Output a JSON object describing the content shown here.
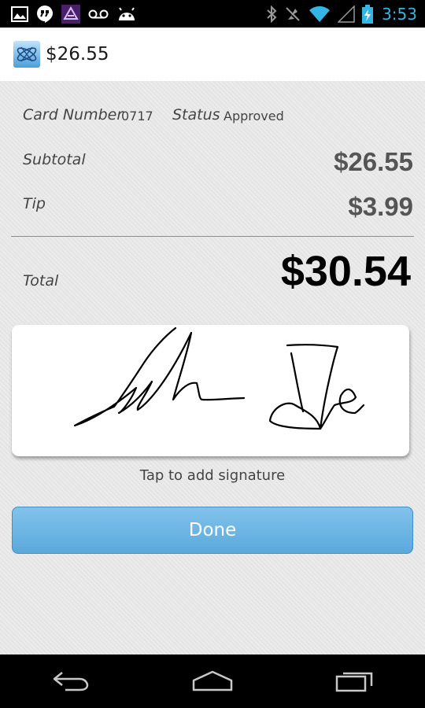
{
  "status_bar": {
    "time": "3:53",
    "time_color": "#33b5e5",
    "notification_icons": [
      "gallery-icon",
      "hangouts-icon",
      "app-notification-icon",
      "voicemail-icon",
      "android-icon"
    ],
    "system_icons": [
      "bluetooth-icon",
      "mute-icon",
      "wifi-icon",
      "signal-icon",
      "battery-charging-icon"
    ]
  },
  "action_bar": {
    "title": "$26.55",
    "icon": "app-logo-icon"
  },
  "receipt": {
    "card_number_label": "Card Number",
    "card_number_value": "0717",
    "status_label": "Status",
    "status_value": "Approved",
    "subtotal_label": "Subtotal",
    "subtotal_value": "$26.55",
    "tip_label": "Tip",
    "tip_value": "$3.99",
    "total_label": "Total",
    "total_value": "$30.54"
  },
  "signature": {
    "hint": "Tap to add signature"
  },
  "done_button": {
    "label": "Done",
    "color": "#6fb6e4"
  },
  "nav_bar": {
    "buttons": [
      "back-icon",
      "home-icon",
      "recent-apps-icon"
    ]
  }
}
